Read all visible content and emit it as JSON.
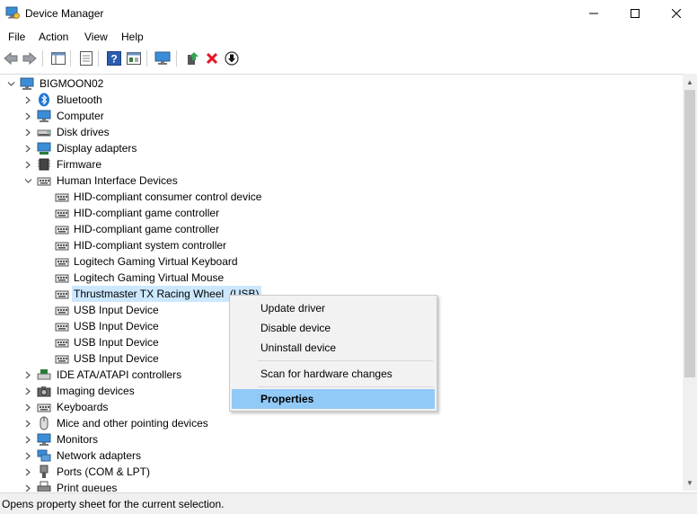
{
  "window": {
    "title": "Device Manager"
  },
  "menu": [
    "File",
    "Action",
    "View",
    "Help"
  ],
  "toolbar": {
    "icons": [
      "back-icon",
      "forward-icon",
      "properties-grid-icon",
      "list-view-icon",
      "help-icon",
      "resources-icon",
      "monitor-icon",
      "update-driver-icon",
      "uninstall-icon",
      "download-icon"
    ]
  },
  "tree": {
    "root": "BIGMOON02",
    "categories_top": [
      {
        "label": "Bluetooth",
        "icon": "bluetooth-icon"
      },
      {
        "label": "Computer",
        "icon": "computer-icon"
      },
      {
        "label": "Disk drives",
        "icon": "disk-drive-icon"
      },
      {
        "label": "Display adapters",
        "icon": "display-adapter-icon"
      },
      {
        "label": "Firmware",
        "icon": "firmware-icon"
      }
    ],
    "hid_label": "Human Interface Devices",
    "hid_children": [
      "HID-compliant consumer control device",
      "HID-compliant game controller",
      "HID-compliant game controller",
      "HID-compliant system controller",
      "Logitech Gaming Virtual Keyboard",
      "Logitech Gaming Virtual Mouse",
      "Thrustmaster TX Racing Wheel  (USB)",
      "USB Input Device",
      "USB Input Device",
      "USB Input Device",
      "USB Input Device"
    ],
    "selected_index": 6,
    "categories_bottom": [
      {
        "label": "IDE ATA/ATAPI controllers",
        "icon": "ide-controller-icon"
      },
      {
        "label": "Imaging devices",
        "icon": "camera-icon"
      },
      {
        "label": "Keyboards",
        "icon": "keyboard-icon"
      },
      {
        "label": "Mice and other pointing devices",
        "icon": "mouse-icon"
      },
      {
        "label": "Monitors",
        "icon": "monitor-icon"
      },
      {
        "label": "Network adapters",
        "icon": "network-adapter-icon"
      },
      {
        "label": "Ports (COM & LPT)",
        "icon": "port-icon"
      },
      {
        "label": "Print queues",
        "icon": "printer-icon"
      }
    ]
  },
  "context_menu": {
    "items": [
      "Update driver",
      "Disable device",
      "Uninstall device",
      "Scan for hardware changes",
      "Properties"
    ],
    "highlighted": "Properties"
  },
  "status": {
    "text": "Opens property sheet for the current selection."
  },
  "colors": {
    "selection": "#cce8ff",
    "menu_highlight": "#91c9f7",
    "uninstall_red": "#e81123"
  }
}
